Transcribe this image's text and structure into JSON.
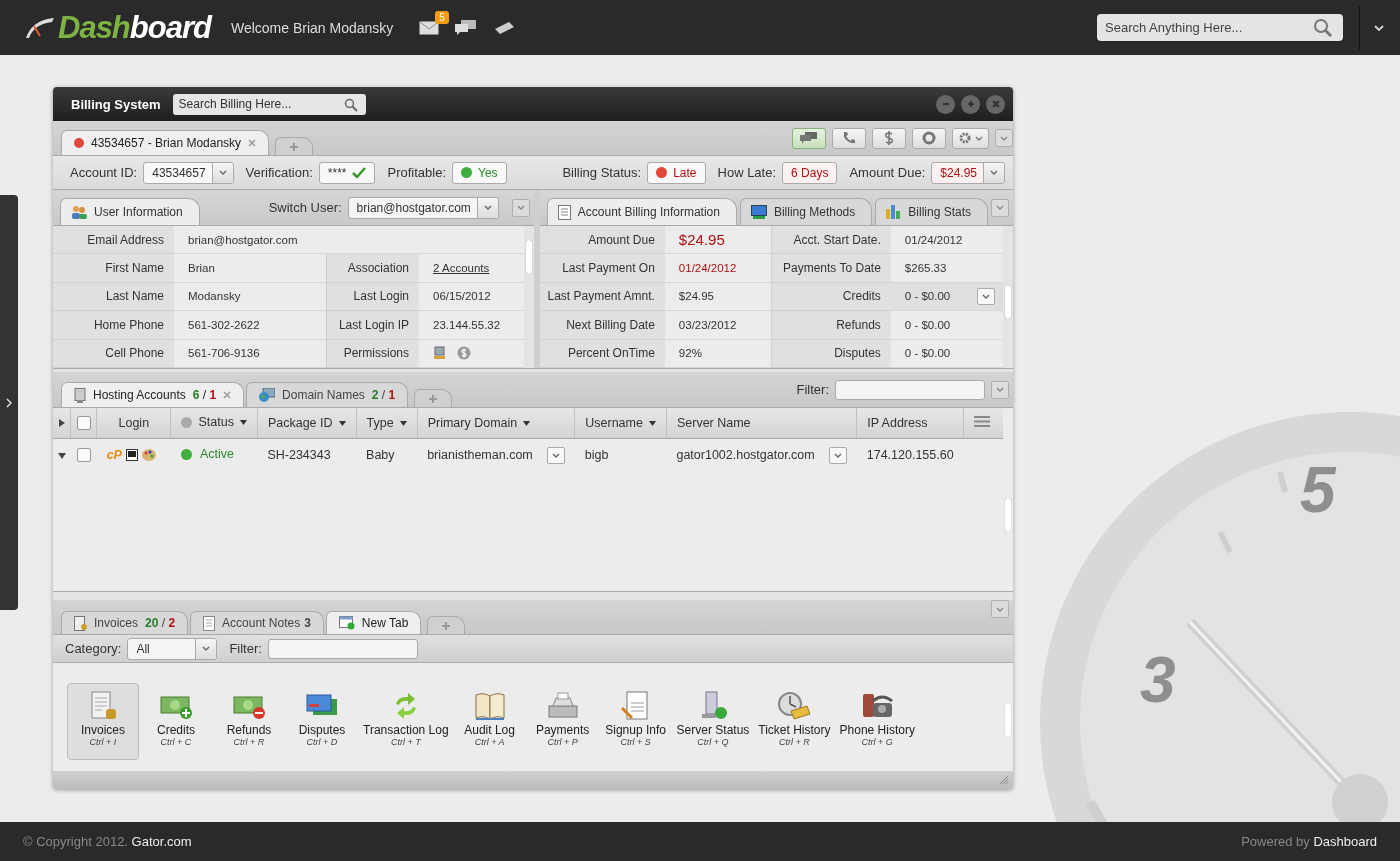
{
  "header": {
    "logo_a": "Dash",
    "logo_b": "board",
    "welcome": "Welcome Brian Modansky",
    "mail_count": "5",
    "search_placeholder": "Search Anything Here..."
  },
  "window": {
    "title": "Billing System",
    "search_placeholder": "Search Billing Here..."
  },
  "account_tabs": [
    {
      "label": "43534657 - Brian Modansky",
      "selected": true,
      "closable": true
    }
  ],
  "toolbar": [
    {
      "kind": "chat",
      "selected": true
    },
    {
      "kind": "phone",
      "selected": false
    },
    {
      "kind": "dollar",
      "selected": false
    },
    {
      "kind": "lifebuoy",
      "selected": false
    },
    {
      "kind": "gear",
      "selected": false
    }
  ],
  "summary_left": [
    {
      "label": "Account ID:",
      "value": "43534657",
      "kind": "select"
    },
    {
      "label": "Verification:",
      "value": "****",
      "kind": "check"
    },
    {
      "label": "Profitable:",
      "value": "Yes",
      "kind": "dot",
      "color": "#3fae3f"
    }
  ],
  "summary_right": [
    {
      "label": "Billing Status:",
      "value": "Late",
      "kind": "dot",
      "color": "#e0483a"
    },
    {
      "label": "How Late:",
      "value": "6 Days",
      "kind": "alert"
    },
    {
      "label": "Amount Due:",
      "value": "$24.95",
      "kind": "alert-select"
    }
  ],
  "user_panel": {
    "tab": "User Information",
    "switch_label": "Switch User:",
    "switch_value": "brian@hostgator.com",
    "rows": [
      {
        "label": "Email Address",
        "value": "brian@hostgator.com",
        "kind": "wide"
      },
      {
        "label": "First Name",
        "value": "Brian",
        "label2": "Association",
        "value2": "2 Accounts",
        "kind": "link"
      },
      {
        "label": "Last Name",
        "value": "Modansky",
        "label2": "Last Login",
        "value2": "06/15/2012",
        "kind": "text"
      },
      {
        "label": "Home Phone",
        "value": "561-302-2622",
        "label2": "Last Login IP",
        "value2": "23.144.55.32",
        "kind": "text"
      },
      {
        "label": "Cell Phone",
        "value": "561-706-9136",
        "label2": "Permissions",
        "kind": "icons"
      }
    ]
  },
  "billing_panel": {
    "tabs": [
      {
        "label": "Account Billing Information",
        "kind": "doc",
        "selected": true
      },
      {
        "label": "Billing Methods",
        "kind": "screen",
        "selected": false
      },
      {
        "label": "Billing Stats",
        "kind": "bars",
        "selected": false
      }
    ],
    "rows": [
      {
        "label": "Amount Due",
        "value": "$24.95",
        "alert": true,
        "large": true,
        "label2": "Acct. Start Date.",
        "value2": "01/24/2012",
        "dropdown": false
      },
      {
        "label": "Last Payment On",
        "value": "01/24/2012",
        "alert": true,
        "large": false,
        "label2": "Payments To Date",
        "value2": "$265.33",
        "dropdown": false
      },
      {
        "label": "Last Payment Amnt.",
        "value": "$24.95",
        "alert": false,
        "large": false,
        "label2": "Credits",
        "value2": "0 - $0.00",
        "dropdown": true
      },
      {
        "label": "Next Billing Date",
        "value": "03/23/2012",
        "alert": false,
        "large": false,
        "label2": "Refunds",
        "value2": "0 - $0.00",
        "dropdown": false
      },
      {
        "label": "Percent OnTime",
        "value": "92%",
        "alert": false,
        "large": false,
        "label2": "Disputes",
        "value2": "0 - $0.00",
        "dropdown": false
      }
    ]
  },
  "hosting_tabs": [
    {
      "label": "Hosting Accounts",
      "kind": "server",
      "good": "6",
      "sep": "/",
      "bad": "1",
      "selected": true,
      "closable": true
    },
    {
      "label": "Domain Names",
      "kind": "globe",
      "good": "2",
      "sep": "/",
      "bad": "1",
      "selected": false,
      "closable": false
    }
  ],
  "hosting_filter": "Filter:",
  "select_all": {
    "checked": false
  },
  "columns": [
    {
      "label": "Login",
      "sortable": false,
      "dot": false
    },
    {
      "label": "Status",
      "sortable": true,
      "dot": true
    },
    {
      "label": "Package ID",
      "sortable": true,
      "dot": false
    },
    {
      "label": "Type",
      "sortable": true,
      "dot": false
    },
    {
      "label": "Primary Domain",
      "sortable": true,
      "dot": false
    },
    {
      "label": "Username",
      "sortable": true,
      "dot": false
    },
    {
      "label": "Server Name",
      "sortable": false,
      "dot": false
    },
    {
      "label": "IP Address",
      "sortable": false,
      "dot": false
    }
  ],
  "rows": [
    {
      "checked": false,
      "expanded": true,
      "login": "cP",
      "status": "Active",
      "package": "SH-234343",
      "type": "Baby",
      "domain": "brianistheman.com",
      "username": "bigb",
      "server": "gator1002.hostgator.com",
      "ip": "174.120.155.60"
    }
  ],
  "bottom_tabs": [
    {
      "label": "Invoices",
      "kind": "invoice",
      "good": "20",
      "sep": "/",
      "bad": "2",
      "selected": false
    },
    {
      "label": "Account Notes",
      "kind": "note",
      "count": "3",
      "selected": false
    },
    {
      "label": "New Tab",
      "kind": "newtab",
      "selected": true
    }
  ],
  "category": {
    "label": "Category:",
    "value": "All",
    "filter": "Filter:"
  },
  "tools": [
    {
      "kind": "invoice",
      "label": "Invoices",
      "shortcut": "Ctrl + I",
      "selected": true
    },
    {
      "kind": "credit",
      "label": "Credits",
      "shortcut": "Ctrl + C",
      "selected": false
    },
    {
      "kind": "refund",
      "label": "Refunds",
      "shortcut": "Ctrl + R",
      "selected": false
    },
    {
      "kind": "card",
      "label": "Disputes",
      "shortcut": "Ctrl + D",
      "selected": false
    },
    {
      "kind": "sync",
      "label": "Transaction Log",
      "shortcut": "Ctrl + T",
      "selected": false
    },
    {
      "kind": "book",
      "label": "Audit Log",
      "shortcut": "Ctrl + A",
      "selected": false
    },
    {
      "kind": "register",
      "label": "Payments",
      "shortcut": "Ctrl + P",
      "selected": false
    },
    {
      "kind": "signup",
      "label": "Signup Info",
      "shortcut": "Ctrl + S",
      "selected": false
    },
    {
      "kind": "server",
      "label": "Server Status",
      "shortcut": "Ctrl + Q",
      "selected": false
    },
    {
      "kind": "ticket",
      "label": "Ticket History",
      "shortcut": "Ctrl + R",
      "selected": false
    },
    {
      "kind": "phone",
      "label": "Phone History",
      "shortcut": "Ctrl + G",
      "selected": false
    }
  ],
  "gauge": {
    "labels": [
      "3",
      "5"
    ]
  },
  "footer": {
    "copyright": "© Copyright 2012.",
    "site": "Gator.com",
    "powered": "Powered by",
    "brand": "Dashboard"
  }
}
